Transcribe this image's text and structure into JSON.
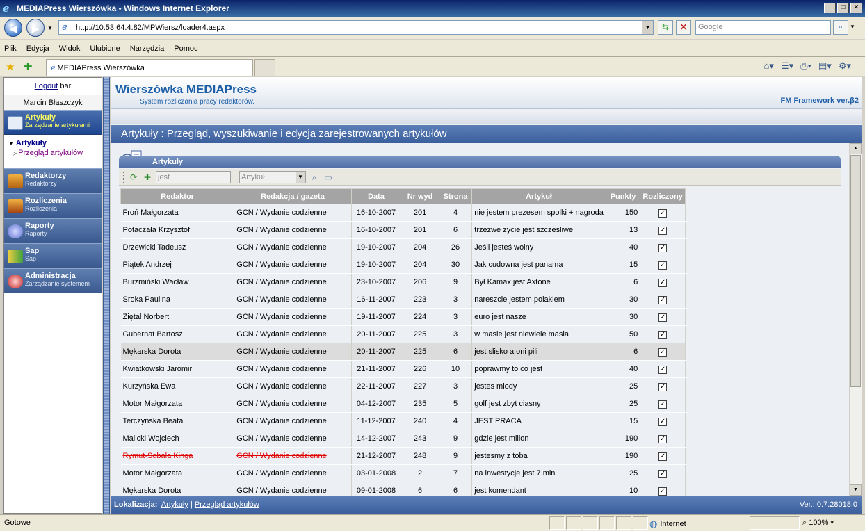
{
  "window": {
    "title": "MEDIAPress Wierszówka - Windows Internet Explorer",
    "url": "http://10.53.64.4:82/MPWiersz/loader4.aspx",
    "search_placeholder": "Google",
    "menu": [
      "Plik",
      "Edycja",
      "Widok",
      "Ulubione",
      "Narzędzia",
      "Pomoc"
    ],
    "tab_label": "MEDIAPress Wierszówka",
    "status": "Gotowe",
    "zone": "Internet",
    "zoom": "100%"
  },
  "sidebar": {
    "logout": "Logout",
    "logout_suffix": "bar",
    "user": "Marcin Błaszczyk",
    "active": {
      "title": "Artykuły",
      "subtitle": "Zarządzanie artykułami"
    },
    "subnav_title": "Artykuły",
    "subnav_item": "Przegląd artykułów",
    "sections": [
      {
        "title": "Redaktorzy",
        "subtitle": "Redaktorzy"
      },
      {
        "title": "Rozliczenia",
        "subtitle": "Rozliczenia"
      },
      {
        "title": "Raporty",
        "subtitle": "Raporty"
      },
      {
        "title": "Sap",
        "subtitle": "Sap"
      },
      {
        "title": "Administracja",
        "subtitle": "Zarządzanie systemem"
      }
    ]
  },
  "header": {
    "title": "Wierszówka MEDIAPress",
    "subtitle": "System rozliczania pracy redaktorów.",
    "framework": "FM Framework ver.β2",
    "page_title": "Artykuły : Przegląd, wyszukiwanie i edycja zarejestrowanych artykułów"
  },
  "panel": {
    "title": "Artykuły",
    "search_value": "jest",
    "search_field": "Artykuł"
  },
  "grid": {
    "columns": [
      "Redaktor",
      "Redakcja / gazeta",
      "Data",
      "Nr wyd",
      "Strona",
      "Artykuł",
      "Punkty",
      "Rozliczony"
    ],
    "rows": [
      [
        "Froń Małgorzata",
        "GCN / Wydanie codzienne",
        "16-10-2007",
        "201",
        "4",
        "nie jestem prezesem spolki + nagroda",
        "150",
        true
      ],
      [
        "Potaczała Krzysztof",
        "GCN / Wydanie codzienne",
        "16-10-2007",
        "201",
        "6",
        "trzezwe zycie jest szczesliwe",
        "13",
        true
      ],
      [
        "Drzewicki Tadeusz",
        "GCN / Wydanie codzienne",
        "19-10-2007",
        "204",
        "26",
        "Jeśli jesteś wolny",
        "40",
        true
      ],
      [
        "Piątek Andrzej",
        "GCN / Wydanie codzienne",
        "19-10-2007",
        "204",
        "30",
        "Jak cudowna jest panama",
        "15",
        true
      ],
      [
        "Burzmiński Wacław",
        "GCN / Wydanie codzienne",
        "23-10-2007",
        "206",
        "9",
        "Był Kamax jest Axtone",
        "6",
        true
      ],
      [
        "Sroka Paulina",
        "GCN / Wydanie codzienne",
        "16-11-2007",
        "223",
        "3",
        "nareszcie jestem polakiem",
        "30",
        true
      ],
      [
        "Ziętal Norbert",
        "GCN / Wydanie codzienne",
        "19-11-2007",
        "224",
        "3",
        "euro jest nasze",
        "30",
        true
      ],
      [
        "Gubernat Bartosz",
        "GCN / Wydanie codzienne",
        "20-11-2007",
        "225",
        "3",
        "w masle jest niewiele masla",
        "50",
        true
      ],
      [
        "Mękarska Dorota",
        "GCN / Wydanie codzienne",
        "20-11-2007",
        "225",
        "6",
        "jest slisko a oni pili",
        "6",
        true
      ],
      [
        "Kwiatkowski Jaromir",
        "GCN / Wydanie codzienne",
        "21-11-2007",
        "226",
        "10",
        "poprawmy to co jest",
        "40",
        true
      ],
      [
        "Kurzyńska Ewa",
        "GCN / Wydanie codzienne",
        "22-11-2007",
        "227",
        "3",
        "jestes mlody",
        "25",
        true
      ],
      [
        "Motor Małgorzata",
        "GCN / Wydanie codzienne",
        "04-12-2007",
        "235",
        "5",
        "golf jest zbyt ciasny",
        "25",
        true
      ],
      [
        "Terczyńska Beata",
        "GCN / Wydanie codzienne",
        "11-12-2007",
        "240",
        "4",
        "JEST PRACA",
        "15",
        true
      ],
      [
        "Malicki Wojciech",
        "GCN / Wydanie codzienne",
        "14-12-2007",
        "243",
        "9",
        "gdzie jest milion",
        "190",
        true
      ],
      [
        "Rymut-Sobala Kinga",
        "GCN / Wydanie codzienne",
        "21-12-2007",
        "248",
        "9",
        "jestesmy z toba",
        "190",
        true
      ],
      [
        "Motor Małgorzata",
        "GCN / Wydanie codzienne",
        "03-01-2008",
        "2",
        "7",
        "na inwestycje jest 7 mln",
        "25",
        true
      ],
      [
        "Mękarska Dorota",
        "GCN / Wydanie codzienne",
        "09-01-2008",
        "6",
        "6",
        "jest komendant",
        "10",
        true
      ]
    ],
    "highlighted_row": 8,
    "strikethrough_row": 14
  },
  "footer": {
    "location_label": "Lokalizacja:",
    "crumb1": "Artykuły",
    "crumb2": "Przegląd artykułów",
    "version": "Ver.: 0.7.28018.0"
  }
}
